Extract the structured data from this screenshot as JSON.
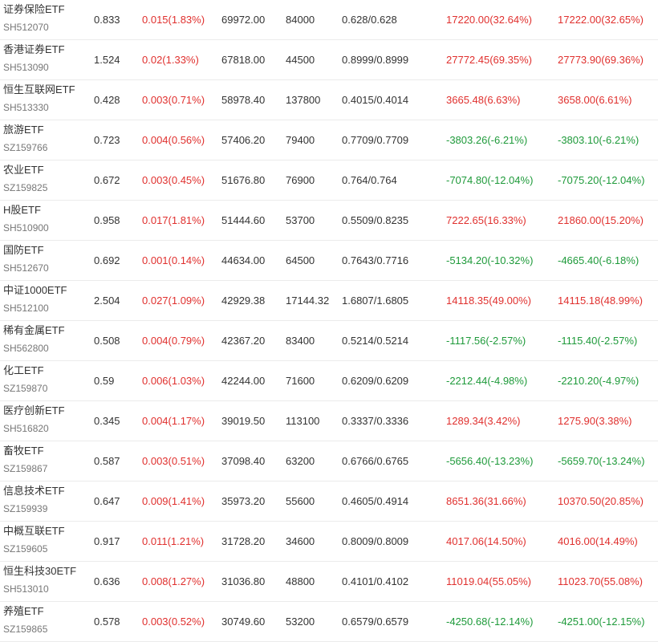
{
  "colors": {
    "up": "#e0302e",
    "down": "#1e9a3a",
    "text": "#333333",
    "subtext": "#777777"
  },
  "rows": [
    {
      "name": "证券保险ETF",
      "code": "SH512070",
      "price": "0.833",
      "change": "0.015(1.83%)",
      "volume": "69972.00",
      "shares": "84000",
      "nav": "0.628/0.628",
      "pl1": "17220.00(32.64%)",
      "pl2": "17222.00(32.65%)",
      "trend": "up",
      "pl_trend": "up"
    },
    {
      "name": "香港证券ETF",
      "code": "SH513090",
      "price": "1.524",
      "change": "0.02(1.33%)",
      "volume": "67818.00",
      "shares": "44500",
      "nav": "0.8999/0.8999",
      "pl1": "27772.45(69.35%)",
      "pl2": "27773.90(69.36%)",
      "trend": "up",
      "pl_trend": "up"
    },
    {
      "name": "恒生互联网ETF",
      "code": "SH513330",
      "price": "0.428",
      "change": "0.003(0.71%)",
      "volume": "58978.40",
      "shares": "137800",
      "nav": "0.4015/0.4014",
      "pl1": "3665.48(6.63%)",
      "pl2": "3658.00(6.61%)",
      "trend": "up",
      "pl_trend": "up"
    },
    {
      "name": "旅游ETF",
      "code": "SZ159766",
      "price": "0.723",
      "change": "0.004(0.56%)",
      "volume": "57406.20",
      "shares": "79400",
      "nav": "0.7709/0.7709",
      "pl1": "-3803.26(-6.21%)",
      "pl2": "-3803.10(-6.21%)",
      "trend": "up",
      "pl_trend": "down"
    },
    {
      "name": "农业ETF",
      "code": "SZ159825",
      "price": "0.672",
      "change": "0.003(0.45%)",
      "volume": "51676.80",
      "shares": "76900",
      "nav": "0.764/0.764",
      "pl1": "-7074.80(-12.04%)",
      "pl2": "-7075.20(-12.04%)",
      "trend": "up",
      "pl_trend": "down"
    },
    {
      "name": "H股ETF",
      "code": "SH510900",
      "price": "0.958",
      "change": "0.017(1.81%)",
      "volume": "51444.60",
      "shares": "53700",
      "nav": "0.5509/0.8235",
      "pl1": "7222.65(16.33%)",
      "pl2": "21860.00(15.20%)",
      "trend": "up",
      "pl_trend": "up"
    },
    {
      "name": "国防ETF",
      "code": "SH512670",
      "price": "0.692",
      "change": "0.001(0.14%)",
      "volume": "44634.00",
      "shares": "64500",
      "nav": "0.7643/0.7716",
      "pl1": "-5134.20(-10.32%)",
      "pl2": "-4665.40(-6.18%)",
      "trend": "up",
      "pl_trend": "down"
    },
    {
      "name": "中证1000ETF",
      "code": "SH512100",
      "price": "2.504",
      "change": "0.027(1.09%)",
      "volume": "42929.38",
      "shares": "17144.32",
      "nav": "1.6807/1.6805",
      "pl1": "14118.35(49.00%)",
      "pl2": "14115.18(48.99%)",
      "trend": "up",
      "pl_trend": "up"
    },
    {
      "name": "稀有金属ETF",
      "code": "SH562800",
      "price": "0.508",
      "change": "0.004(0.79%)",
      "volume": "42367.20",
      "shares": "83400",
      "nav": "0.5214/0.5214",
      "pl1": "-1117.56(-2.57%)",
      "pl2": "-1115.40(-2.57%)",
      "trend": "up",
      "pl_trend": "down"
    },
    {
      "name": "化工ETF",
      "code": "SZ159870",
      "price": "0.59",
      "change": "0.006(1.03%)",
      "volume": "42244.00",
      "shares": "71600",
      "nav": "0.6209/0.6209",
      "pl1": "-2212.44(-4.98%)",
      "pl2": "-2210.20(-4.97%)",
      "trend": "up",
      "pl_trend": "down"
    },
    {
      "name": "医疗创新ETF",
      "code": "SH516820",
      "price": "0.345",
      "change": "0.004(1.17%)",
      "volume": "39019.50",
      "shares": "113100",
      "nav": "0.3337/0.3336",
      "pl1": "1289.34(3.42%)",
      "pl2": "1275.90(3.38%)",
      "trend": "up",
      "pl_trend": "up"
    },
    {
      "name": "畜牧ETF",
      "code": "SZ159867",
      "price": "0.587",
      "change": "0.003(0.51%)",
      "volume": "37098.40",
      "shares": "63200",
      "nav": "0.6766/0.6765",
      "pl1": "-5656.40(-13.23%)",
      "pl2": "-5659.70(-13.24%)",
      "trend": "up",
      "pl_trend": "down"
    },
    {
      "name": "信息技术ETF",
      "code": "SZ159939",
      "price": "0.647",
      "change": "0.009(1.41%)",
      "volume": "35973.20",
      "shares": "55600",
      "nav": "0.4605/0.4914",
      "pl1": "8651.36(31.66%)",
      "pl2": "10370.50(20.85%)",
      "trend": "up",
      "pl_trend": "up"
    },
    {
      "name": "中概互联ETF",
      "code": "SZ159605",
      "price": "0.917",
      "change": "0.011(1.21%)",
      "volume": "31728.20",
      "shares": "34600",
      "nav": "0.8009/0.8009",
      "pl1": "4017.06(14.50%)",
      "pl2": "4016.00(14.49%)",
      "trend": "up",
      "pl_trend": "up"
    },
    {
      "name": "恒生科技30ETF",
      "code": "SH513010",
      "price": "0.636",
      "change": "0.008(1.27%)",
      "volume": "31036.80",
      "shares": "48800",
      "nav": "0.4101/0.4102",
      "pl1": "11019.04(55.05%)",
      "pl2": "11023.70(55.08%)",
      "trend": "up",
      "pl_trend": "up"
    },
    {
      "name": "养殖ETF",
      "code": "SZ159865",
      "price": "0.578",
      "change": "0.003(0.52%)",
      "volume": "30749.60",
      "shares": "53200",
      "nav": "0.6579/0.6579",
      "pl1": "-4250.68(-12.14%)",
      "pl2": "-4251.00(-12.15%)",
      "trend": "up",
      "pl_trend": "down"
    }
  ]
}
